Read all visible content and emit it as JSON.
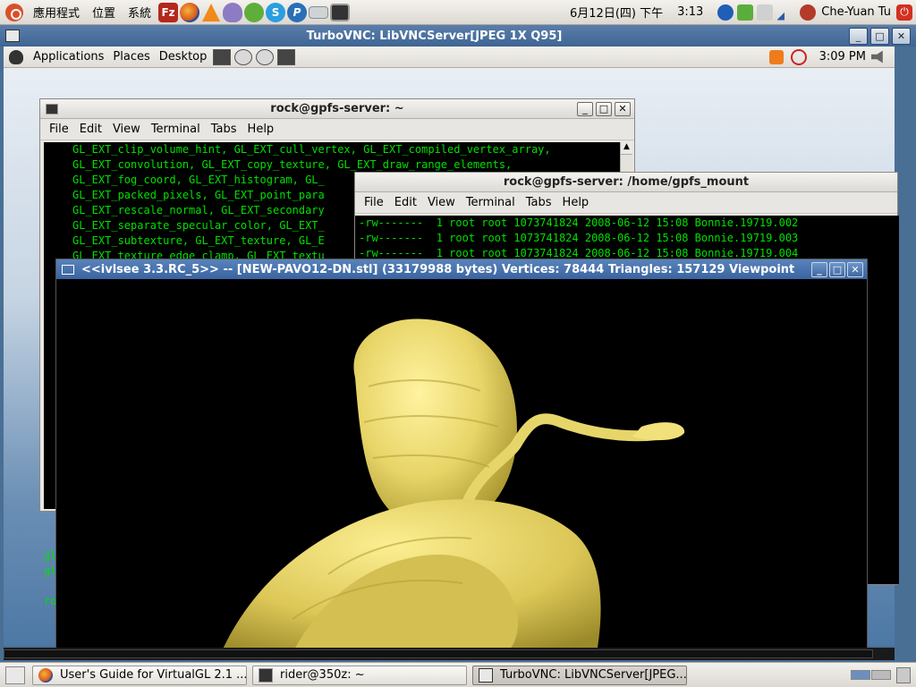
{
  "host_panel": {
    "menus": [
      "應用程式",
      "位置",
      "系統"
    ],
    "launchers": [
      "filezilla-icon",
      "firefox-icon",
      "vlc-icon",
      "pidgin-icon",
      "messenger-icon",
      "skype-icon",
      "pandora-icon",
      "drive-icon",
      "terminal-icon"
    ],
    "date": "6月12日(四) 下午",
    "clock": "3:13",
    "user": "Che-Yuan Tu"
  },
  "vnc_window": {
    "title": "TurboVNC: LibVNCServer[JPEG 1X Q95]",
    "buttons": [
      "_",
      "□",
      "✕"
    ]
  },
  "remote_panel": {
    "menus": [
      "Applications",
      "Places",
      "Desktop"
    ],
    "clock": "3:09 PM"
  },
  "terminal_rock_home": {
    "title": "rock@gpfs-server: ~",
    "menu": [
      "File",
      "Edit",
      "View",
      "Terminal",
      "Tabs",
      "Help"
    ],
    "lines": [
      "GL_EXT_clip_volume_hint, GL_EXT_cull_vertex, GL_EXT_compiled_vertex_array,",
      "GL_EXT_convolution, GL_EXT_copy_texture, GL_EXT_draw_range_elements,",
      "GL_EXT_fog_coord, GL_EXT_histogram, GL_",
      "GL_EXT_packed_pixels, GL_EXT_point_para",
      "GL_EXT_rescale_normal, GL_EXT_secondary",
      "GL_EXT_separate_specular_color, GL_EXT_",
      "GL_EXT_subtexture, GL_EXT_texture, GL_E",
      "GL_EXT_texture_edge_clamp, GL_EXT_textu"
    ],
    "lower_lines": [
      "gl",
      "gl",
      "",
      "ro"
    ]
  },
  "terminal_gpfs_mount": {
    "title": "rock@gpfs-server: /home/gpfs_mount",
    "menu": [
      "File",
      "Edit",
      "View",
      "Terminal",
      "Tabs",
      "Help"
    ],
    "lines": [
      "-rw-------  1 root root 1073741824 2008-06-12 15:08 Bonnie.19719.002",
      "-rw-------  1 root root 1073741824 2008-06-12 15:08 Bonnie.19719.003",
      "-rw-------  1 root root 1073741824 2008-06-12 15:08 Bonnie.19719.004"
    ]
  },
  "viewer": {
    "title": "<<ivlsee 3.3.RC_5>>  --  [NEW-PAVO12-DN.stl] (33179988 bytes)   Vertices: 78444   Triangles: 157129   Viewpoint",
    "model_color": "#e6d66a"
  },
  "taskbar": {
    "tasks": [
      {
        "label": "User's Guide for VirtualGL 2.1 ...",
        "icon": "firefox-icon"
      },
      {
        "label": "rider@350z: ~",
        "icon": "terminal-icon"
      },
      {
        "label": "TurboVNC: LibVNCServer[JPEG...",
        "icon": "vnc-icon"
      }
    ]
  }
}
